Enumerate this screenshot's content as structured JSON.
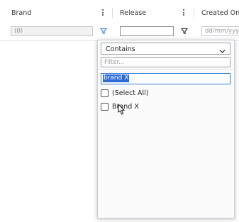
{
  "header": {
    "columns": [
      {
        "label": "Brand"
      },
      {
        "label": "Release"
      },
      {
        "label": "Created On"
      }
    ]
  },
  "floating_filters": {
    "brand_value": "(0)",
    "release_value": "",
    "created_placeholder": "dd/mm/yyyy"
  },
  "popup": {
    "operator_selected": "Contains",
    "filter_placeholder": "Filter...",
    "search_value": "brand X",
    "search_hint": "...",
    "options": [
      {
        "label": "(Select All)",
        "checked": false
      },
      {
        "label": "Brand X",
        "checked": false
      }
    ]
  },
  "colors": {
    "accent": "#2e6bd6",
    "border": "#dde2eb",
    "funnel_active": "#2f7bd6"
  },
  "icons": [
    "column-menu-icon",
    "filter-funnel-icon",
    "chevron-down-icon",
    "mouse-cursor-icon"
  ]
}
